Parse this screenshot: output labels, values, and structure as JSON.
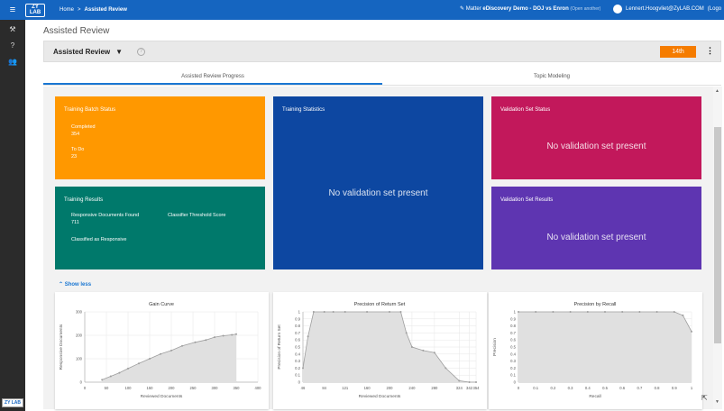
{
  "topbar": {
    "logo": "ZY LAB",
    "crumb_home": "Home",
    "crumb_sep": ">",
    "crumb_current": "Assisted Review",
    "matter_prefix": "Matter ",
    "matter_name": "eDiscovery Demo - DOJ vs Enron",
    "matter_hint": "(Open another)",
    "user_email": "Lennert.Hoogvliet@ZyLAB.COM",
    "logout": "(Logo"
  },
  "sidebar": {
    "icons": [
      "wrench-icon",
      "help-icon",
      "people-icon"
    ],
    "bottom_logo": "ZY LAB"
  },
  "page": {
    "title": "Assisted Review",
    "dropdown_label": "Assisted Review",
    "date_button": "14th"
  },
  "tabs": [
    {
      "label": "Assisted Review Progress",
      "active": true
    },
    {
      "label": "Topic Modeling",
      "active": false
    }
  ],
  "cards": {
    "training_batch": {
      "title": "Training Batch Status",
      "completed_label": "Completed",
      "completed_value": "354",
      "todo_label": "To Do",
      "todo_value": "23",
      "color": "#ff9800"
    },
    "training_stats": {
      "title": "Training Statistics",
      "message": "No validation set present",
      "color": "#0d47a1"
    },
    "validation_status": {
      "title": "Validation Set Status",
      "message": "No validation set present",
      "color": "#c2185b"
    },
    "training_results": {
      "title": "Training Results",
      "responsive_label": "Responsive Documents Found",
      "responsive_value": "711",
      "threshold_label": "Classifier Threshold Score",
      "classified_label": "Classified as Responsive",
      "color": "#00796b"
    },
    "validation_results": {
      "title": "Validation Set Results",
      "message": "No validation set present",
      "color": "#5e35b1"
    }
  },
  "show_less": "Show less",
  "chart_data": [
    {
      "type": "line",
      "title": "Gain Curve",
      "xlabel": "Reviewed Documents",
      "ylabel": "Responsive Documents",
      "xlim": [
        0,
        400
      ],
      "ylim": [
        0,
        300
      ],
      "xticks": [
        0,
        50,
        100,
        150,
        200,
        250,
        300,
        350,
        400
      ],
      "yticks": [
        0,
        100,
        200,
        300
      ],
      "x": [
        40,
        60,
        80,
        100,
        125,
        150,
        175,
        200,
        225,
        255,
        280,
        300,
        320,
        340,
        350
      ],
      "y": [
        10,
        25,
        40,
        58,
        80,
        100,
        120,
        135,
        155,
        170,
        180,
        192,
        198,
        202,
        205
      ],
      "grid": true
    },
    {
      "type": "area",
      "title": "Precision of Return Set",
      "xlabel": "Reviewed Documents",
      "ylabel": "Precision of Return Set",
      "xlim": [
        46,
        354
      ],
      "ylim": [
        0,
        1.0
      ],
      "xticks": [
        46,
        84,
        121,
        160,
        200,
        240,
        280,
        324,
        342,
        354
      ],
      "yticks": [
        0,
        0.1,
        0.2,
        0.3,
        0.4,
        0.5,
        0.6,
        0.7,
        0.8,
        0.9,
        1.0
      ],
      "x": [
        46,
        55,
        65,
        84,
        100,
        121,
        160,
        200,
        220,
        230,
        240,
        260,
        280,
        300,
        324,
        342,
        354
      ],
      "y": [
        0.2,
        0.65,
        1.0,
        1.0,
        1.0,
        1.0,
        1.0,
        1.0,
        1.0,
        0.7,
        0.5,
        0.45,
        0.42,
        0.2,
        0.02,
        0.0,
        0.0
      ],
      "grid": true
    },
    {
      "type": "area",
      "title": "Precision by Recall",
      "xlabel": "Recall",
      "ylabel": "Precision",
      "xlim": [
        0,
        1.0
      ],
      "ylim": [
        0,
        1.0
      ],
      "xticks": [
        0.0,
        0.1,
        0.2,
        0.3,
        0.4,
        0.5,
        0.6,
        0.7,
        0.8,
        0.9,
        1.0
      ],
      "yticks": [
        0,
        0.1,
        0.2,
        0.3,
        0.4,
        0.5,
        0.6,
        0.7,
        0.8,
        0.9,
        1.0
      ],
      "x": [
        0.0,
        0.1,
        0.2,
        0.3,
        0.4,
        0.5,
        0.6,
        0.7,
        0.8,
        0.9,
        0.95,
        1.0
      ],
      "y": [
        1.0,
        1.0,
        1.0,
        1.0,
        1.0,
        1.0,
        1.0,
        1.0,
        1.0,
        1.0,
        0.95,
        0.72
      ],
      "grid": true
    }
  ]
}
